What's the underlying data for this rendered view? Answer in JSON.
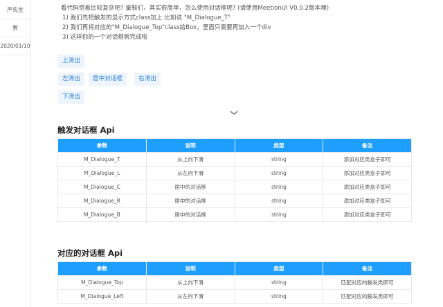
{
  "sidebar": {
    "rows": [
      "严先生",
      "男",
      "2020/01/10"
    ]
  },
  "intro": {
    "lines": [
      "看代码觉着比较复杂吧? 童鞋们，其实很简单，怎么使用对话框呢? (请使用MeetionUi V0.0.2版本噢)",
      "1) 我们先把触发的显示方式class加上 比如说 \"M_Dialogue_T\"",
      "2) 我们再将对应的\"M_Dialogue_Top\"class给Box，里面只需要再加入一个div",
      "3) 这样你的一个对话框就完成啦"
    ]
  },
  "buttons": {
    "up": "上滑出",
    "left": "左滑出",
    "center": "居中对话框",
    "right": "右滑出",
    "down": "下滑出"
  },
  "section1": {
    "title": "触发对话框  Api",
    "headers": [
      "参数",
      "说明",
      "类型",
      "备注"
    ],
    "rows": [
      [
        "M_Dialogue_T",
        "从上向下滑",
        "string",
        "添加对应类盒子即可"
      ],
      [
        "M_Dialogue_L",
        "从左向下滑",
        "string",
        "添加对应类盒子即可"
      ],
      [
        "M_Dialogue_C",
        "居中的对话框",
        "string",
        "添加对应类盒子即可"
      ],
      [
        "M_Dialogue_R",
        "居中的对话框",
        "string",
        "添加对应类盒子即可"
      ],
      [
        "M_Dialogue_B",
        "居中的对话框",
        "string",
        "添加对应类盒子即可"
      ]
    ]
  },
  "section2": {
    "title": "对应的对话框  Api",
    "headers": [
      "参数",
      "说明",
      "类型",
      "备注"
    ],
    "rows": [
      [
        "M_Dialogue_Top",
        "从上向下滑",
        "string",
        "匹配对应的触发类即可"
      ],
      [
        "M_Dialogue_Left",
        "从左向下滑",
        "string",
        "匹配对应的触发类即可"
      ]
    ]
  },
  "colors": {
    "accent": "#1e9fff",
    "button_bg": "#eef4fc",
    "button_text": "#2b82d9"
  }
}
